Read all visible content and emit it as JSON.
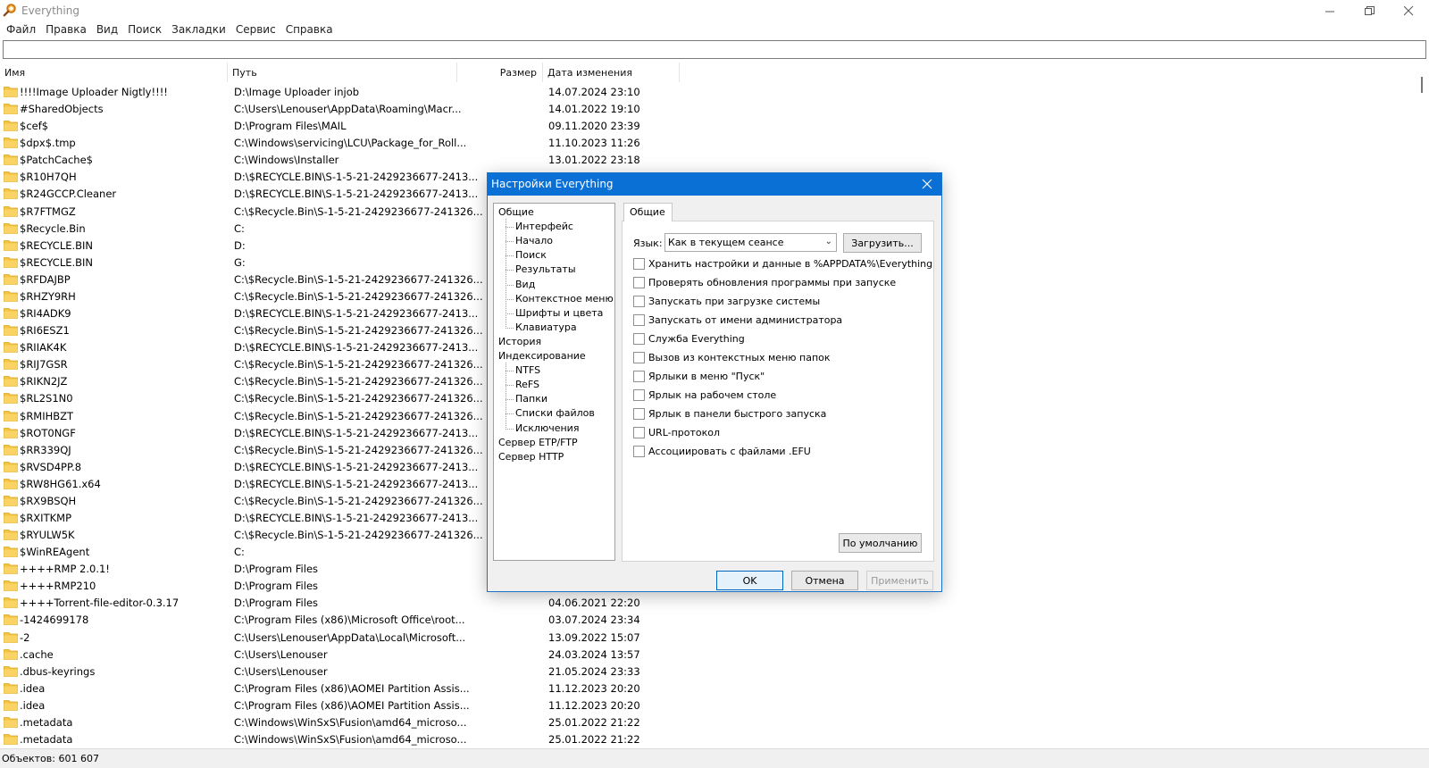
{
  "window": {
    "title": "Everything"
  },
  "menu": [
    "Файл",
    "Правка",
    "Вид",
    "Поиск",
    "Закладки",
    "Сервис",
    "Справка"
  ],
  "columns": {
    "name": "Имя",
    "path": "Путь",
    "size": "Размер",
    "date": "Дата изменения"
  },
  "rows": [
    {
      "name": "!!!!Image Uploader Nigtly!!!!",
      "path": "D:\\Image Uploader injob",
      "date": "14.07.2024 23:10"
    },
    {
      "name": "#SharedObjects",
      "path": "C:\\Users\\Lenouser\\AppData\\Roaming\\Macr...",
      "date": "14.01.2022 19:10"
    },
    {
      "name": "$cef$",
      "path": "D:\\Program Files\\MAIL",
      "date": "09.11.2020 23:39"
    },
    {
      "name": "$dpx$.tmp",
      "path": "C:\\Windows\\servicing\\LCU\\Package_for_Roll...",
      "date": "11.10.2023 11:26"
    },
    {
      "name": "$PatchCache$",
      "path": "C:\\Windows\\Installer",
      "date": "13.01.2022 23:18"
    },
    {
      "name": "$R10H7QH",
      "path": "D:\\$RECYCLE.BIN\\S-1-5-21-2429236677-2413...",
      "date": ""
    },
    {
      "name": "$R24GCCP.Cleaner",
      "path": "D:\\$RECYCLE.BIN\\S-1-5-21-2429236677-2413...",
      "date": ""
    },
    {
      "name": "$R7FTMGZ",
      "path": "C:\\$Recycle.Bin\\S-1-5-21-2429236677-241326...",
      "date": ""
    },
    {
      "name": "$Recycle.Bin",
      "path": "C:",
      "date": ""
    },
    {
      "name": "$RECYCLE.BIN",
      "path": "D:",
      "date": ""
    },
    {
      "name": "$RECYCLE.BIN",
      "path": "G:",
      "date": ""
    },
    {
      "name": "$RFDAJBP",
      "path": "C:\\$Recycle.Bin\\S-1-5-21-2429236677-241326...",
      "date": ""
    },
    {
      "name": "$RHZY9RH",
      "path": "C:\\$Recycle.Bin\\S-1-5-21-2429236677-241326...",
      "date": ""
    },
    {
      "name": "$RI4ADK9",
      "path": "D:\\$RECYCLE.BIN\\S-1-5-21-2429236677-2413...",
      "date": ""
    },
    {
      "name": "$RI6ESZ1",
      "path": "C:\\$Recycle.Bin\\S-1-5-21-2429236677-241326...",
      "date": ""
    },
    {
      "name": "$RIIAK4K",
      "path": "D:\\$RECYCLE.BIN\\S-1-5-21-2429236677-2413...",
      "date": ""
    },
    {
      "name": "$RIJ7GSR",
      "path": "C:\\$Recycle.Bin\\S-1-5-21-2429236677-241326...",
      "date": ""
    },
    {
      "name": "$RIKN2JZ",
      "path": "C:\\$Recycle.Bin\\S-1-5-21-2429236677-241326...",
      "date": ""
    },
    {
      "name": "$RL2S1N0",
      "path": "C:\\$Recycle.Bin\\S-1-5-21-2429236677-241326...",
      "date": ""
    },
    {
      "name": "$RMIHBZT",
      "path": "C:\\$Recycle.Bin\\S-1-5-21-2429236677-241326...",
      "date": ""
    },
    {
      "name": "$ROT0NGF",
      "path": "D:\\$RECYCLE.BIN\\S-1-5-21-2429236677-2413...",
      "date": ""
    },
    {
      "name": "$RR339QJ",
      "path": "C:\\$Recycle.Bin\\S-1-5-21-2429236677-241326...",
      "date": ""
    },
    {
      "name": "$RVSD4PP.8",
      "path": "D:\\$RECYCLE.BIN\\S-1-5-21-2429236677-2413...",
      "date": ""
    },
    {
      "name": "$RW8HG61.x64",
      "path": "D:\\$RECYCLE.BIN\\S-1-5-21-2429236677-2413...",
      "date": ""
    },
    {
      "name": "$RX9BSQH",
      "path": "C:\\$Recycle.Bin\\S-1-5-21-2429236677-241326...",
      "date": ""
    },
    {
      "name": "$RXITKMP",
      "path": "D:\\$RECYCLE.BIN\\S-1-5-21-2429236677-2413...",
      "date": ""
    },
    {
      "name": "$RYULW5K",
      "path": "C:\\$Recycle.Bin\\S-1-5-21-2429236677-241326...",
      "date": ""
    },
    {
      "name": "$WinREAgent",
      "path": "C:",
      "date": ""
    },
    {
      "name": "++++RMP 2.0.1!",
      "path": "D:\\Program Files",
      "date": ""
    },
    {
      "name": "++++RMP210",
      "path": "D:\\Program Files",
      "date": ""
    },
    {
      "name": "++++Torrent-file-editor-0.3.17",
      "path": "D:\\Program Files",
      "date": "04.06.2021 22:20"
    },
    {
      "name": "-1424699178",
      "path": "C:\\Program Files (x86)\\Microsoft Office\\root...",
      "date": "03.07.2024 23:34"
    },
    {
      "name": "-2",
      "path": "C:\\Users\\Lenouser\\AppData\\Local\\Microsoft...",
      "date": "13.09.2022 15:07"
    },
    {
      "name": ".cache",
      "path": "C:\\Users\\Lenouser",
      "date": "24.03.2024 13:57"
    },
    {
      "name": ".dbus-keyrings",
      "path": "C:\\Users\\Lenouser",
      "date": "21.05.2024 23:33"
    },
    {
      "name": ".idea",
      "path": "C:\\Program Files (x86)\\AOMEI Partition Assis...",
      "date": "11.12.2023 20:20"
    },
    {
      "name": ".idea",
      "path": "C:\\Program Files (x86)\\AOMEI Partition Assis...",
      "date": "11.12.2023 20:20"
    },
    {
      "name": ".metadata",
      "path": "C:\\Windows\\WinSxS\\Fusion\\amd64_microso...",
      "date": "25.01.2022 21:22"
    },
    {
      "name": ".metadata",
      "path": "C:\\Windows\\WinSxS\\Fusion\\amd64_microso...",
      "date": "25.01.2022 21:22"
    }
  ],
  "status": {
    "text": "Объектов: 601 607"
  },
  "dialog": {
    "title": "Настройки Everything",
    "tree": [
      {
        "label": "Общие",
        "level": 0
      },
      {
        "label": "Интерфейс",
        "level": 1
      },
      {
        "label": "Начало",
        "level": 1
      },
      {
        "label": "Поиск",
        "level": 1
      },
      {
        "label": "Результаты",
        "level": 1
      },
      {
        "label": "Вид",
        "level": 1
      },
      {
        "label": "Контекстное меню",
        "level": 1
      },
      {
        "label": "Шрифты и цвета",
        "level": 1
      },
      {
        "label": "Клавиатура",
        "level": 1
      },
      {
        "label": "История",
        "level": 0
      },
      {
        "label": "Индексирование",
        "level": 0
      },
      {
        "label": "NTFS",
        "level": 1
      },
      {
        "label": "ReFS",
        "level": 1
      },
      {
        "label": "Папки",
        "level": 1
      },
      {
        "label": "Списки файлов",
        "level": 1
      },
      {
        "label": "Исключения",
        "level": 1
      },
      {
        "label": "Сервер ETP/FTP",
        "level": 0
      },
      {
        "label": "Сервер HTTP",
        "level": 0
      }
    ],
    "tab": "Общие",
    "language_label": "Язык:",
    "language_value": "Как в текущем сеансе",
    "load_button": "Загрузить...",
    "checkboxes": [
      "Хранить настройки и данные в %APPDATA%\\Everything",
      "Проверять обновления программы при запуске",
      "Запускать при загрузке системы",
      "Запускать от имени администратора",
      "Служба Everything",
      "Вызов из контекстных меню папок",
      "Ярлыки в меню \"Пуск\"",
      "Ярлык на рабочем столе",
      "Ярлык в панели быстрого запуска",
      "URL-протокол",
      "Ассоциировать с файлами .EFU"
    ],
    "default_button": "По умолчанию",
    "ok_button": "OK",
    "cancel_button": "Отмена",
    "apply_button": "Применить"
  },
  "colors": {
    "dialog_title_bg": "#0a70d6",
    "folder": "#f4c441"
  }
}
